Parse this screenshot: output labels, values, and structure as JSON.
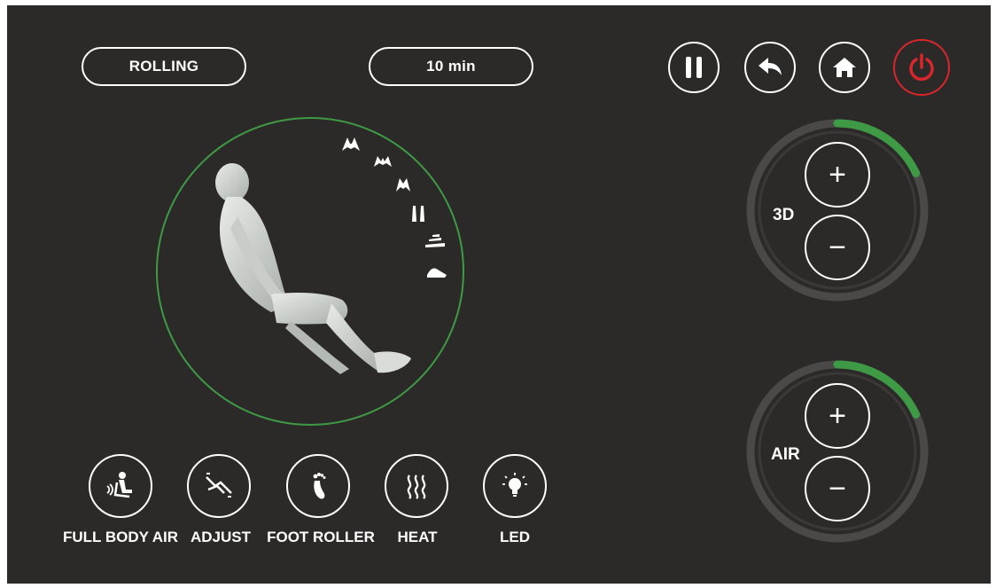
{
  "header": {
    "mode_label": "ROLLING",
    "timer_label": "10 min"
  },
  "controls": {
    "pause_icon": "pause-icon",
    "back_icon": "back-arrow-icon",
    "home_icon": "home-icon",
    "power_icon": "power-icon",
    "power_color": "#d8262a"
  },
  "dials": [
    {
      "label": "3D",
      "plus": "+",
      "minus": "−",
      "level_fraction": 0.18,
      "accent": "#3e9a45"
    },
    {
      "label": "AIR",
      "plus": "+",
      "minus": "−",
      "level_fraction": 0.18,
      "accent": "#3e9a45"
    }
  ],
  "functions": [
    {
      "label": "FULL BODY AIR",
      "icon": "seated-person-air-icon"
    },
    {
      "label": "ADJUST",
      "icon": "adjust-recline-icon"
    },
    {
      "label": "FOOT ROLLER",
      "icon": "foot-icon"
    },
    {
      "label": "HEAT",
      "icon": "heat-waves-icon"
    },
    {
      "label": "LED",
      "icon": "light-bulb-icon"
    }
  ],
  "body_positions": [
    {
      "icon": "shoulders-icon"
    },
    {
      "icon": "upper-back-icon"
    },
    {
      "icon": "mid-back-icon"
    },
    {
      "icon": "lower-back-icon"
    },
    {
      "icon": "waist-icon"
    },
    {
      "icon": "legs-icon"
    }
  ],
  "colors": {
    "background": "#2b2a29",
    "accent_green": "#3e9a45",
    "power_red": "#d8262a"
  }
}
